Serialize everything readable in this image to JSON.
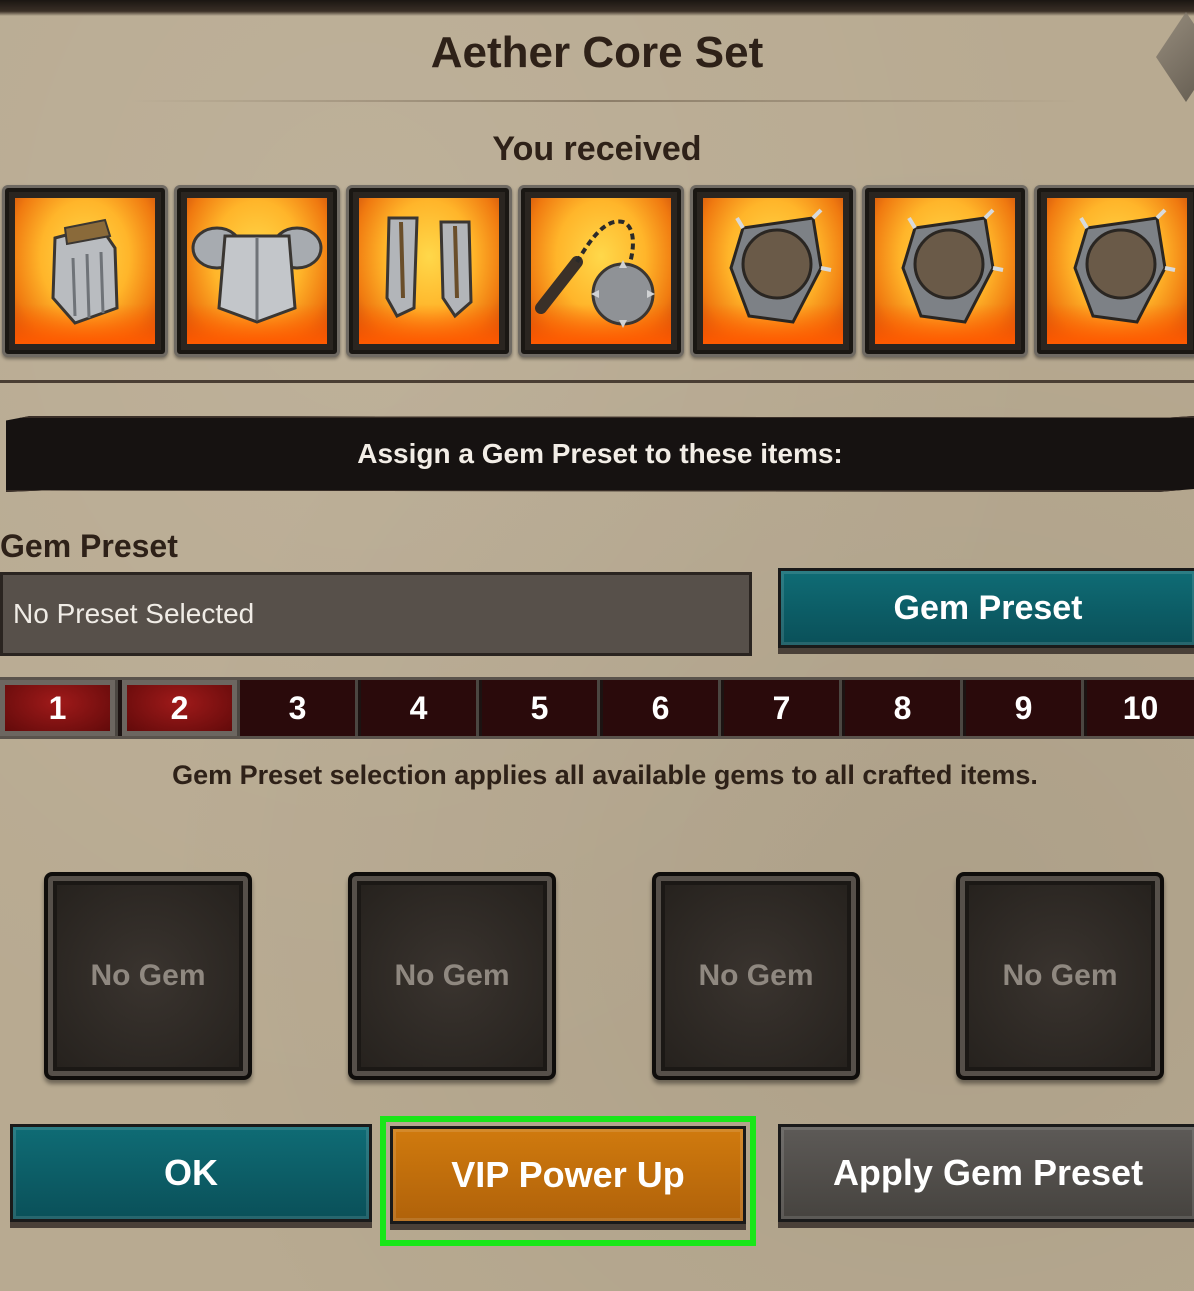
{
  "dialog": {
    "title": "Aether Core Set",
    "received_label": "You received"
  },
  "items": [
    {
      "name": "gauntlet-icon"
    },
    {
      "name": "chest-armor-icon"
    },
    {
      "name": "greaves-icon"
    },
    {
      "name": "flail-icon"
    },
    {
      "name": "shield-icon"
    },
    {
      "name": "shield-icon"
    },
    {
      "name": "shield-icon"
    }
  ],
  "assign_banner": "Assign a Gem Preset to these items:",
  "gem_preset": {
    "label": "Gem Preset",
    "field_value": "No Preset Selected",
    "button_label": "Gem Preset"
  },
  "tabs": [
    "1",
    "2",
    "3",
    "4",
    "5",
    "6",
    "7",
    "8",
    "9",
    "10"
  ],
  "tabs_active": [
    "1",
    "2"
  ],
  "note": "Gem Preset selection applies all available gems to all crafted items.",
  "gem_slots": [
    "No Gem",
    "No Gem",
    "No Gem",
    "No Gem"
  ],
  "buttons": {
    "ok": "OK",
    "vip": "VIP Power Up",
    "apply": "Apply Gem Preset"
  },
  "colors": {
    "parchment": "#b8aa91",
    "teal_button": "#0f6c75",
    "orange_button": "#c0700c",
    "gray_button": "#55524e",
    "highlight": "#19e619"
  }
}
